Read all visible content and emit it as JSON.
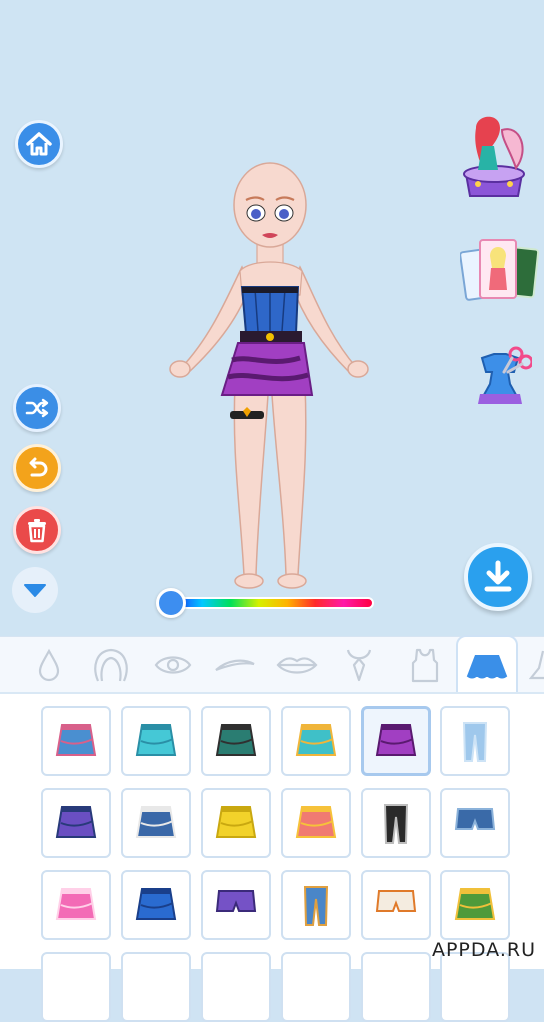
{
  "buttons": {
    "home": "home-icon",
    "shuffle": "shuffle-icon",
    "undo": "undo-icon",
    "trash": "trash-icon",
    "collapse": "chevron-down-icon",
    "download": "download-icon"
  },
  "side_menu": [
    {
      "name": "mermaid-music-box",
      "icon": "mermaid-box-icon"
    },
    {
      "name": "photo-cards",
      "icon": "photo-cards-icon"
    },
    {
      "name": "design-outfit",
      "icon": "dress-scissors-icon"
    }
  ],
  "color_slider": {
    "value": 0
  },
  "categories": [
    {
      "id": "skin",
      "icon": "drop-icon"
    },
    {
      "id": "hair",
      "icon": "hair-icon"
    },
    {
      "id": "eyes",
      "icon": "eye-icon"
    },
    {
      "id": "eyebrows",
      "icon": "eyebrow-icon"
    },
    {
      "id": "lips",
      "icon": "lips-icon"
    },
    {
      "id": "necklace",
      "icon": "necklace-icon"
    },
    {
      "id": "tops",
      "icon": "tank-top-icon"
    },
    {
      "id": "skirts",
      "icon": "skirt-icon",
      "active": true
    },
    {
      "id": "shoes",
      "icon": "shoe-icon"
    }
  ],
  "items": [
    {
      "name": "denim-chain-skirt",
      "colors": [
        "#4a8fd0",
        "#d8608a"
      ]
    },
    {
      "name": "teal-fringe-top-skirt",
      "colors": [
        "#45c8d6",
        "#2a8fa6"
      ]
    },
    {
      "name": "green-plaid-skirt",
      "colors": [
        "#2a7d72",
        "#303030"
      ]
    },
    {
      "name": "teal-fringe-skirt",
      "colors": [
        "#3fc0c8",
        "#f0b53a"
      ]
    },
    {
      "name": "purple-zebra-skirt",
      "colors": [
        "#a13fc2",
        "#5a1a70"
      ],
      "selected": true
    },
    {
      "name": "flared-jeans",
      "colors": [
        "#9fc8ec",
        "#cde3f6"
      ]
    },
    {
      "name": "argyle-skirt",
      "colors": [
        "#6a4fc2",
        "#283a7a"
      ]
    },
    {
      "name": "denim-belt-skirt",
      "colors": [
        "#3a68a8",
        "#e8e8e8"
      ]
    },
    {
      "name": "yellow-button-skirt",
      "colors": [
        "#f2d22a",
        "#c9a810"
      ]
    },
    {
      "name": "coral-flower-skirt",
      "colors": [
        "#f07a72",
        "#f6c23a"
      ]
    },
    {
      "name": "patch-pants",
      "colors": [
        "#2a2a2a",
        "#bdbdbd"
      ]
    },
    {
      "name": "denim-shorts",
      "colors": [
        "#3a6aa8",
        "#8bb2da"
      ]
    },
    {
      "name": "pink-ruched-skirt",
      "colors": [
        "#f36bb6",
        "#ffd0e8"
      ]
    },
    {
      "name": "blue-pleated-skirt",
      "colors": [
        "#2a6bd0",
        "#1a3f8a"
      ]
    },
    {
      "name": "purple-shorts",
      "colors": [
        "#7552c6",
        "#3b2a7a"
      ]
    },
    {
      "name": "patchwork-jeans",
      "colors": [
        "#4a86c8",
        "#e0a040"
      ]
    },
    {
      "name": "white-bow-shorts",
      "colors": [
        "#f4ece0",
        "#e07a2a"
      ]
    },
    {
      "name": "green-star-skirt",
      "colors": [
        "#4f9a3a",
        "#f0c03a"
      ]
    }
  ],
  "watermark": "APPDA.RU"
}
